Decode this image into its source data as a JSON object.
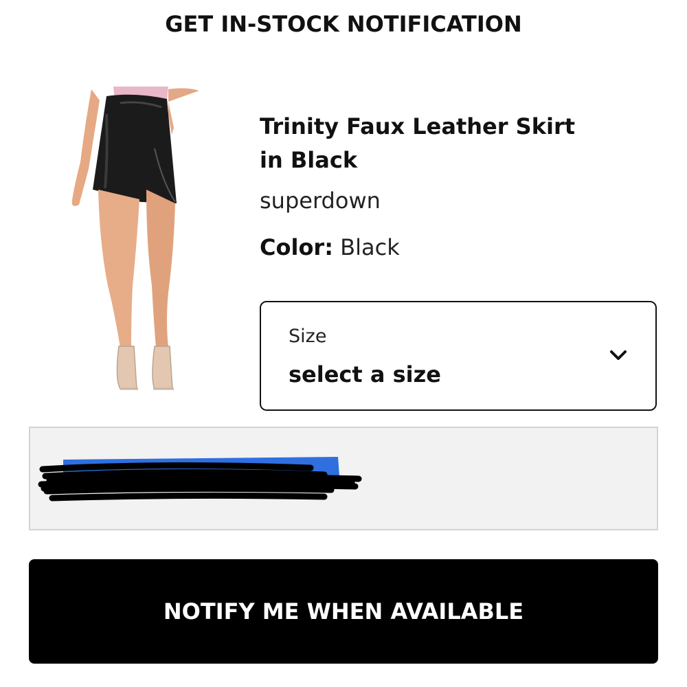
{
  "modal": {
    "title": "GET IN-STOCK NOTIFICATION"
  },
  "product": {
    "name_line1": "Trinity Faux Leather Skirt",
    "name_line2": "in Black",
    "brand": "superdown",
    "color_label": "Color:",
    "color_value": "Black"
  },
  "size_select": {
    "label": "Size",
    "value": "select a size",
    "icon": "chevron-down-icon"
  },
  "email": {
    "value": "",
    "redacted": true
  },
  "notify_button": {
    "label": "NOTIFY ME WHEN AVAILABLE"
  },
  "colors": {
    "button_bg": "#000000",
    "field_bg": "#f2f2f2",
    "redaction_blue": "#2f6fe0"
  }
}
